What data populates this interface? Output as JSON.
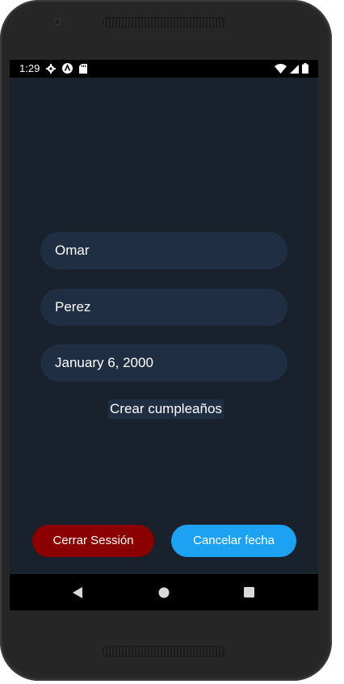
{
  "status_bar": {
    "time": "1:29",
    "icons_left": [
      "gear-icon",
      "a-circle-icon",
      "sd-card-icon"
    ],
    "icons_right": [
      "wifi-icon",
      "signal-icon",
      "battery-icon"
    ]
  },
  "form": {
    "first_name_value": "Omar",
    "last_name_value": "Perez",
    "date_value": "January 6, 2000",
    "create_label": "Crear cumpleaños"
  },
  "actions": {
    "logout_label": "Cerrar Sessión",
    "cancel_label": "Cancelar fecha"
  },
  "nav": {
    "items": [
      "back-icon",
      "home-icon",
      "recents-icon"
    ]
  },
  "colors": {
    "background": "#18212c",
    "field": "#1f2e43",
    "logout": "#8b0000",
    "cancel": "#1da1f2"
  }
}
